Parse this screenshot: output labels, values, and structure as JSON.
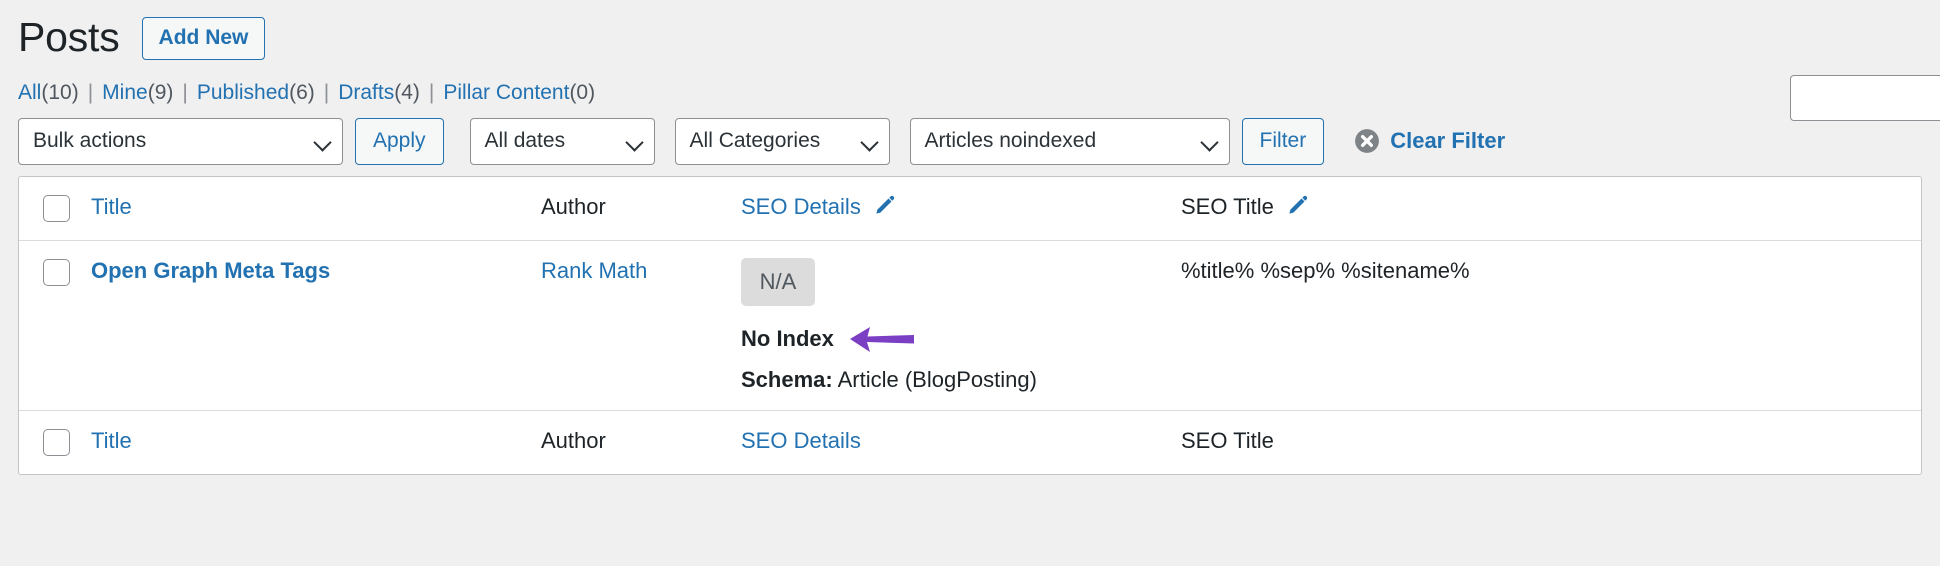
{
  "header": {
    "page_title": "Posts",
    "add_new_label": "Add New"
  },
  "status_links": [
    {
      "label": "All",
      "count": "(10)"
    },
    {
      "label": "Mine",
      "count": "(9)"
    },
    {
      "label": "Published",
      "count": "(6)"
    },
    {
      "label": "Drafts",
      "count": "(4)"
    },
    {
      "label": "Pillar Content",
      "count": "(0)"
    }
  ],
  "search": {
    "value": "",
    "placeholder": ""
  },
  "toolbar": {
    "bulk_actions_value": "Bulk actions",
    "apply_label": "Apply",
    "dates_value": "All dates",
    "categories_value": "All Categories",
    "noindex_value": "Articles noindexed",
    "filter_label": "Filter",
    "clear_filter_label": "Clear Filter"
  },
  "table": {
    "columns": {
      "title": "Title",
      "author": "Author",
      "seo_details": "SEO Details",
      "seo_title": "SEO Title"
    },
    "rows": [
      {
        "title": "Open Graph Meta Tags",
        "author": "Rank Math",
        "score_badge": "N/A",
        "index_status": "No Index",
        "schema_label": "Schema:",
        "schema_value": "Article (BlogPosting)",
        "seo_title": "%title% %sep% %sitename%"
      }
    ]
  },
  "colors": {
    "link": "#2271b1",
    "text": "#1d2327",
    "muted": "#50575e",
    "badge_bg": "#dcdcdc",
    "annotation_arrow": "#7b3fc4",
    "page_bg": "#f0f0f1"
  }
}
